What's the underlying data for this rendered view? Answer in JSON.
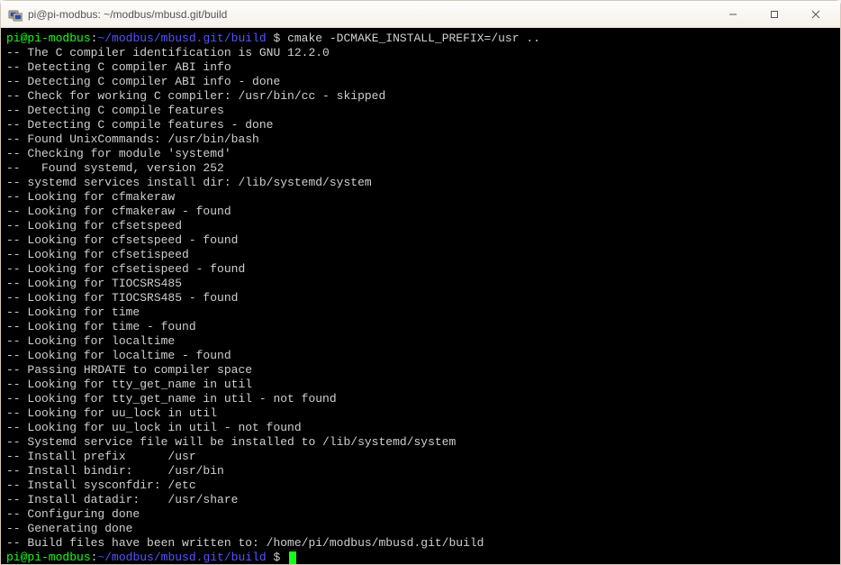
{
  "window": {
    "title": "pi@pi-modbus: ~/modbus/mbusd.git/build"
  },
  "prompt": {
    "user_host": "pi@pi-modbus",
    "sep1": ":",
    "path": "~/modbus/mbusd.git/build",
    "sep2": " $ ",
    "command": "cmake -DCMAKE_INSTALL_PREFIX=/usr .."
  },
  "lines": [
    "-- The C compiler identification is GNU 12.2.0",
    "-- Detecting C compiler ABI info",
    "-- Detecting C compiler ABI info - done",
    "-- Check for working C compiler: /usr/bin/cc - skipped",
    "-- Detecting C compile features",
    "-- Detecting C compile features - done",
    "-- Found UnixCommands: /usr/bin/bash",
    "-- Checking for module 'systemd'",
    "--   Found systemd, version 252",
    "-- systemd services install dir: /lib/systemd/system",
    "-- Looking for cfmakeraw",
    "-- Looking for cfmakeraw - found",
    "-- Looking for cfsetspeed",
    "-- Looking for cfsetspeed - found",
    "-- Looking for cfsetispeed",
    "-- Looking for cfsetispeed - found",
    "-- Looking for TIOCSRS485",
    "-- Looking for TIOCSRS485 - found",
    "-- Looking for time",
    "-- Looking for time - found",
    "-- Looking for localtime",
    "-- Looking for localtime - found",
    "-- Passing HRDATE to compiler space",
    "-- Looking for tty_get_name in util",
    "-- Looking for tty_get_name in util - not found",
    "-- Looking for uu_lock in util",
    "-- Looking for uu_lock in util - not found",
    "-- Systemd service file will be installed to /lib/systemd/system",
    "-- Install prefix      /usr",
    "-- Install bindir:     /usr/bin",
    "-- Install sysconfdir: /etc",
    "-- Install datadir:    /usr/share",
    "-- Configuring done",
    "-- Generating done",
    "-- Build files have been written to: /home/pi/modbus/mbusd.git/build"
  ]
}
